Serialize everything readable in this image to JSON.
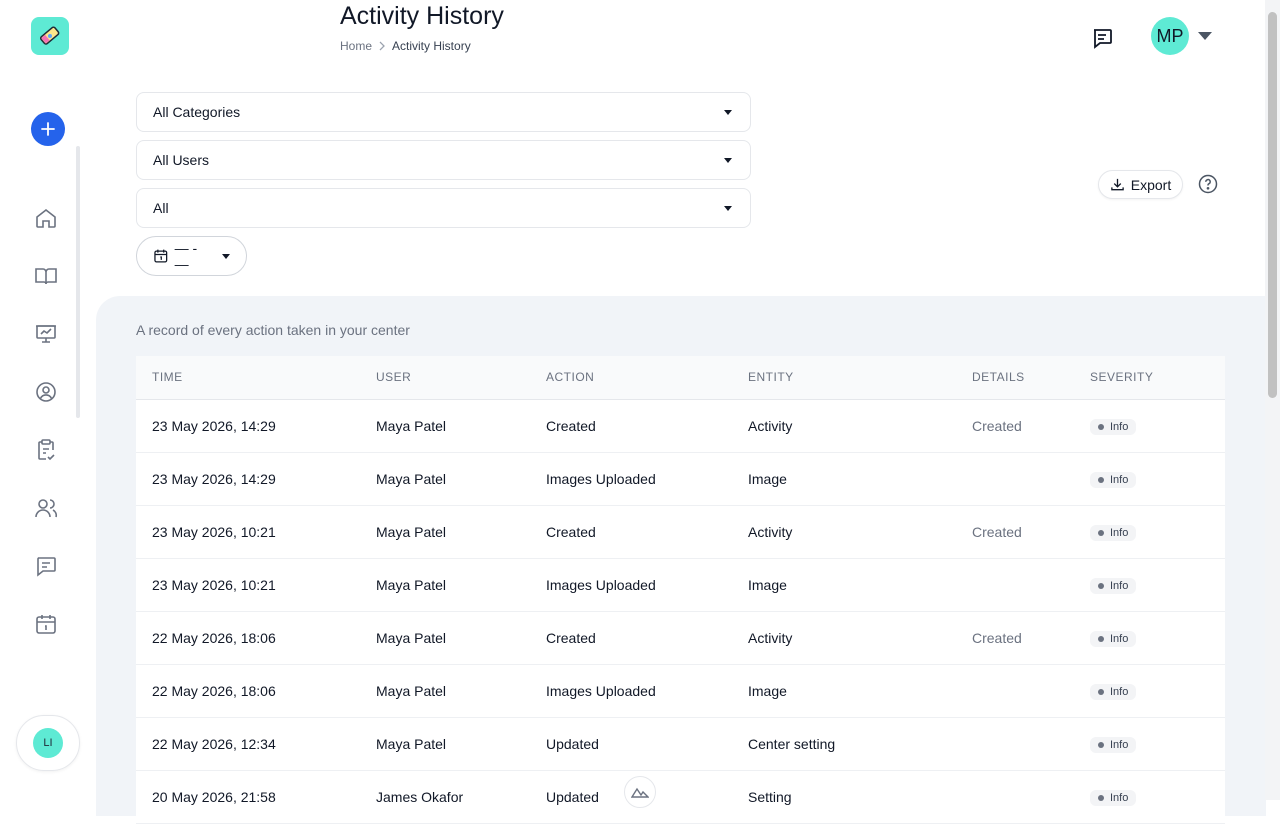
{
  "header": {
    "title": "Activity History",
    "breadcrumb": {
      "home": "Home",
      "current": "Activity History"
    },
    "avatar_initials": "MP"
  },
  "sidebar": {
    "icons": [
      "home-icon",
      "book-icon",
      "presentation-icon",
      "user-circle-icon",
      "clipboard-check-icon",
      "users-icon",
      "message-icon",
      "calendar-icon"
    ],
    "user_initials": "LI"
  },
  "filters": {
    "category": "All Categories",
    "user": "All Users",
    "severity": "All",
    "date_range": "— - —"
  },
  "toolbar": {
    "export_label": "Export"
  },
  "panel": {
    "description": "A record of every action taken in your center"
  },
  "table": {
    "columns": [
      "TIME",
      "USER",
      "ACTION",
      "ENTITY",
      "DETAILS",
      "SEVERITY"
    ],
    "rows": [
      {
        "time": "23 May 2026, 14:29",
        "user": "Maya Patel",
        "action": "Created",
        "entity": "Activity",
        "details": "Created",
        "severity": "Info"
      },
      {
        "time": "23 May 2026, 14:29",
        "user": "Maya Patel",
        "action": "Images Uploaded",
        "entity": "Image",
        "details": "",
        "severity": "Info"
      },
      {
        "time": "23 May 2026, 10:21",
        "user": "Maya Patel",
        "action": "Created",
        "entity": "Activity",
        "details": "Created",
        "severity": "Info"
      },
      {
        "time": "23 May 2026, 10:21",
        "user": "Maya Patel",
        "action": "Images Uploaded",
        "entity": "Image",
        "details": "",
        "severity": "Info"
      },
      {
        "time": "22 May 2026, 18:06",
        "user": "Maya Patel",
        "action": "Created",
        "entity": "Activity",
        "details": "Created",
        "severity": "Info"
      },
      {
        "time": "22 May 2026, 18:06",
        "user": "Maya Patel",
        "action": "Images Uploaded",
        "entity": "Image",
        "details": "",
        "severity": "Info"
      },
      {
        "time": "22 May 2026, 12:34",
        "user": "Maya Patel",
        "action": "Updated",
        "entity": "Center setting",
        "details": "",
        "severity": "Info"
      },
      {
        "time": "20 May 2026, 21:58",
        "user": "James Okafor",
        "action": "Updated",
        "entity": "Setting",
        "details": "",
        "severity": "Info"
      }
    ]
  },
  "colors": {
    "accent": "#2563eb",
    "avatar": "#5eead4",
    "panel_bg": "#f1f4f8"
  }
}
